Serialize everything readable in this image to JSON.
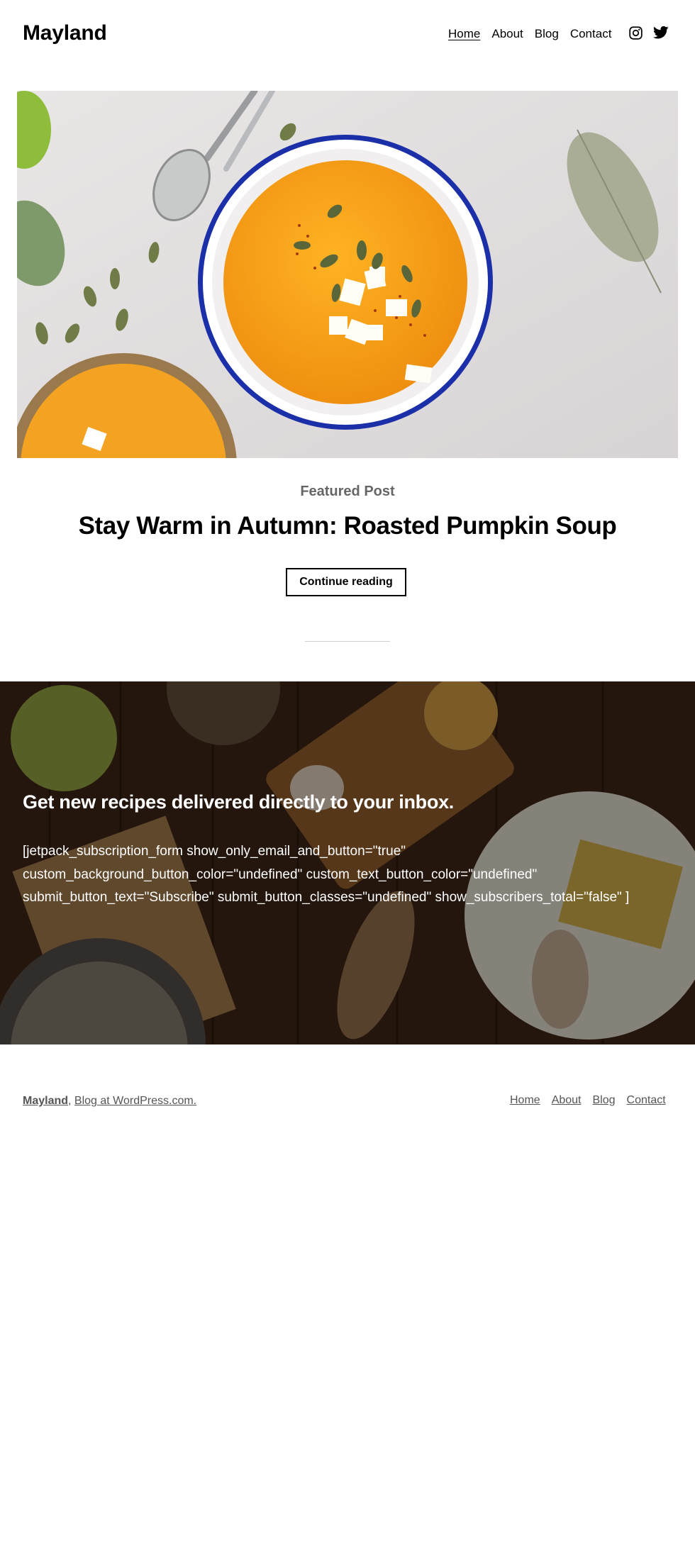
{
  "site": {
    "title": "Mayland"
  },
  "nav": {
    "items": [
      {
        "label": "Home",
        "current": true
      },
      {
        "label": "About"
      },
      {
        "label": "Blog"
      },
      {
        "label": "Contact"
      }
    ]
  },
  "social": {
    "icons": [
      "instagram-icon",
      "twitter-icon"
    ]
  },
  "featured": {
    "label": "Featured Post",
    "title": "Stay Warm in Autumn: Roasted Pumpkin Soup",
    "button_label": "Continue reading"
  },
  "newsletter": {
    "heading": "Get new recipes delivered directly to your inbox.",
    "body": "[jetpack_subscription_form show_only_email_and_button=\"true\" custom_background_button_color=\"undefined\" custom_text_button_color=\"undefined\" submit_button_text=\"Subscribe\" submit_button_classes=\"undefined\" show_subscribers_total=\"false\" ]"
  },
  "footer": {
    "site_link": "Mayland",
    "separator": ", ",
    "wp_link": "Blog at WordPress.com.",
    "nav": [
      "Home",
      "About",
      "Blog",
      "Contact"
    ]
  },
  "colors": {
    "accent_text": "#000000",
    "muted_text": "#555555",
    "soup": "#f5a623",
    "bowl_rim": "#1a2fa8"
  }
}
